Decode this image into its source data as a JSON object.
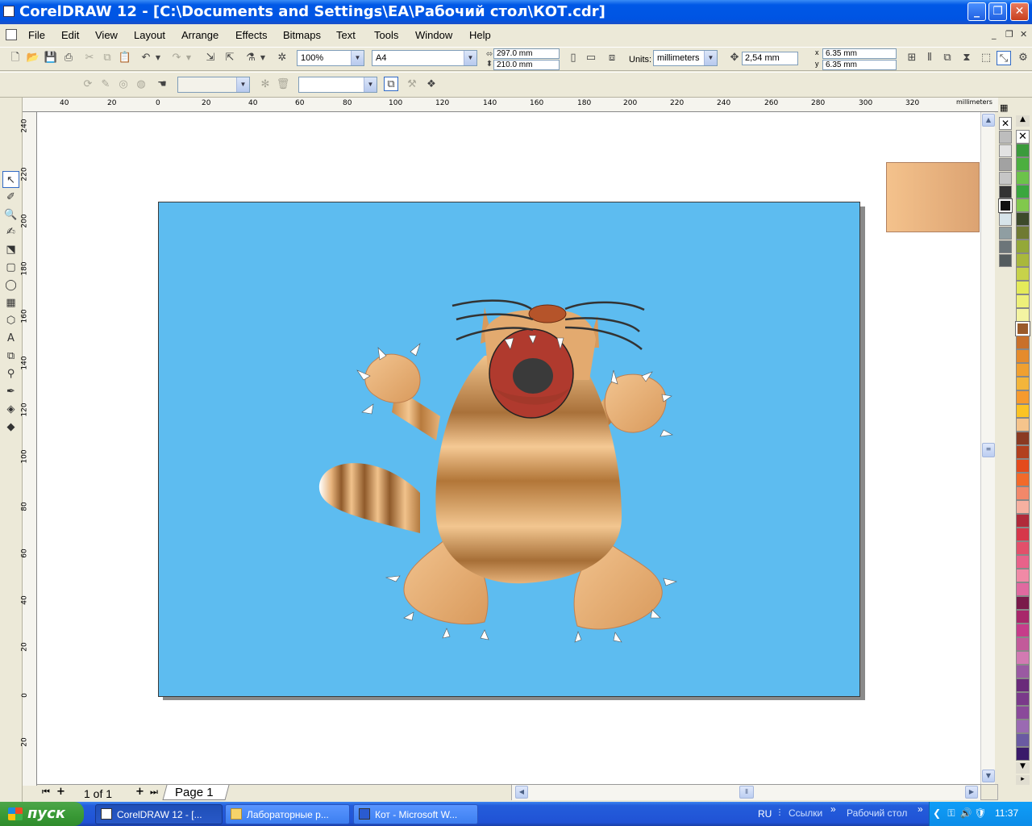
{
  "titlebar": {
    "title": "CorelDRAW 12 - [C:\\Documents and Settings\\EA\\Рабочий стол\\КОТ.cdr]",
    "minimize": "_",
    "maximize": "❐",
    "close": "✕"
  },
  "menu": {
    "items": [
      "File",
      "Edit",
      "View",
      "Layout",
      "Arrange",
      "Effects",
      "Bitmaps",
      "Text",
      "Tools",
      "Window",
      "Help"
    ],
    "mdi_min": "_",
    "mdi_restore": "❐",
    "mdi_close": "✕"
  },
  "toolbar": {
    "zoom": "100%",
    "page_size": "A4",
    "width": "297.0 mm",
    "height": "210.0 mm",
    "units_label": "Units:",
    "units": "millimeters",
    "nudge": "2,54 mm",
    "dup_x": "6.35 mm",
    "dup_y": "6.35 mm",
    "dup_x_label": "x",
    "dup_y_label": "y"
  },
  "ruler": {
    "unit_label": "millimeters",
    "top_ticks": [
      "40",
      "20",
      "0",
      "20",
      "40",
      "60",
      "80",
      "100",
      "120",
      "140",
      "160",
      "180",
      "200",
      "220",
      "240",
      "260",
      "280",
      "300",
      "320"
    ],
    "left_ticks": [
      "240",
      "220",
      "200",
      "180",
      "160",
      "140",
      "120",
      "100",
      "80",
      "60",
      "40",
      "20",
      "0",
      "20"
    ]
  },
  "pages": {
    "counter": "1 of 1",
    "tab": "Page 1"
  },
  "colors": {
    "page_bg": "#5dbcf0",
    "accent": "#0054e3"
  },
  "taskbar": {
    "start": "пуск",
    "tasks": [
      "CorelDRAW 12 - [...",
      "Лабораторные р...",
      "Кот - Microsoft W..."
    ],
    "lang": "RU",
    "links": "Ссылки",
    "desktop": "Рабочий стол",
    "chevron": "»",
    "time": "11:37"
  }
}
